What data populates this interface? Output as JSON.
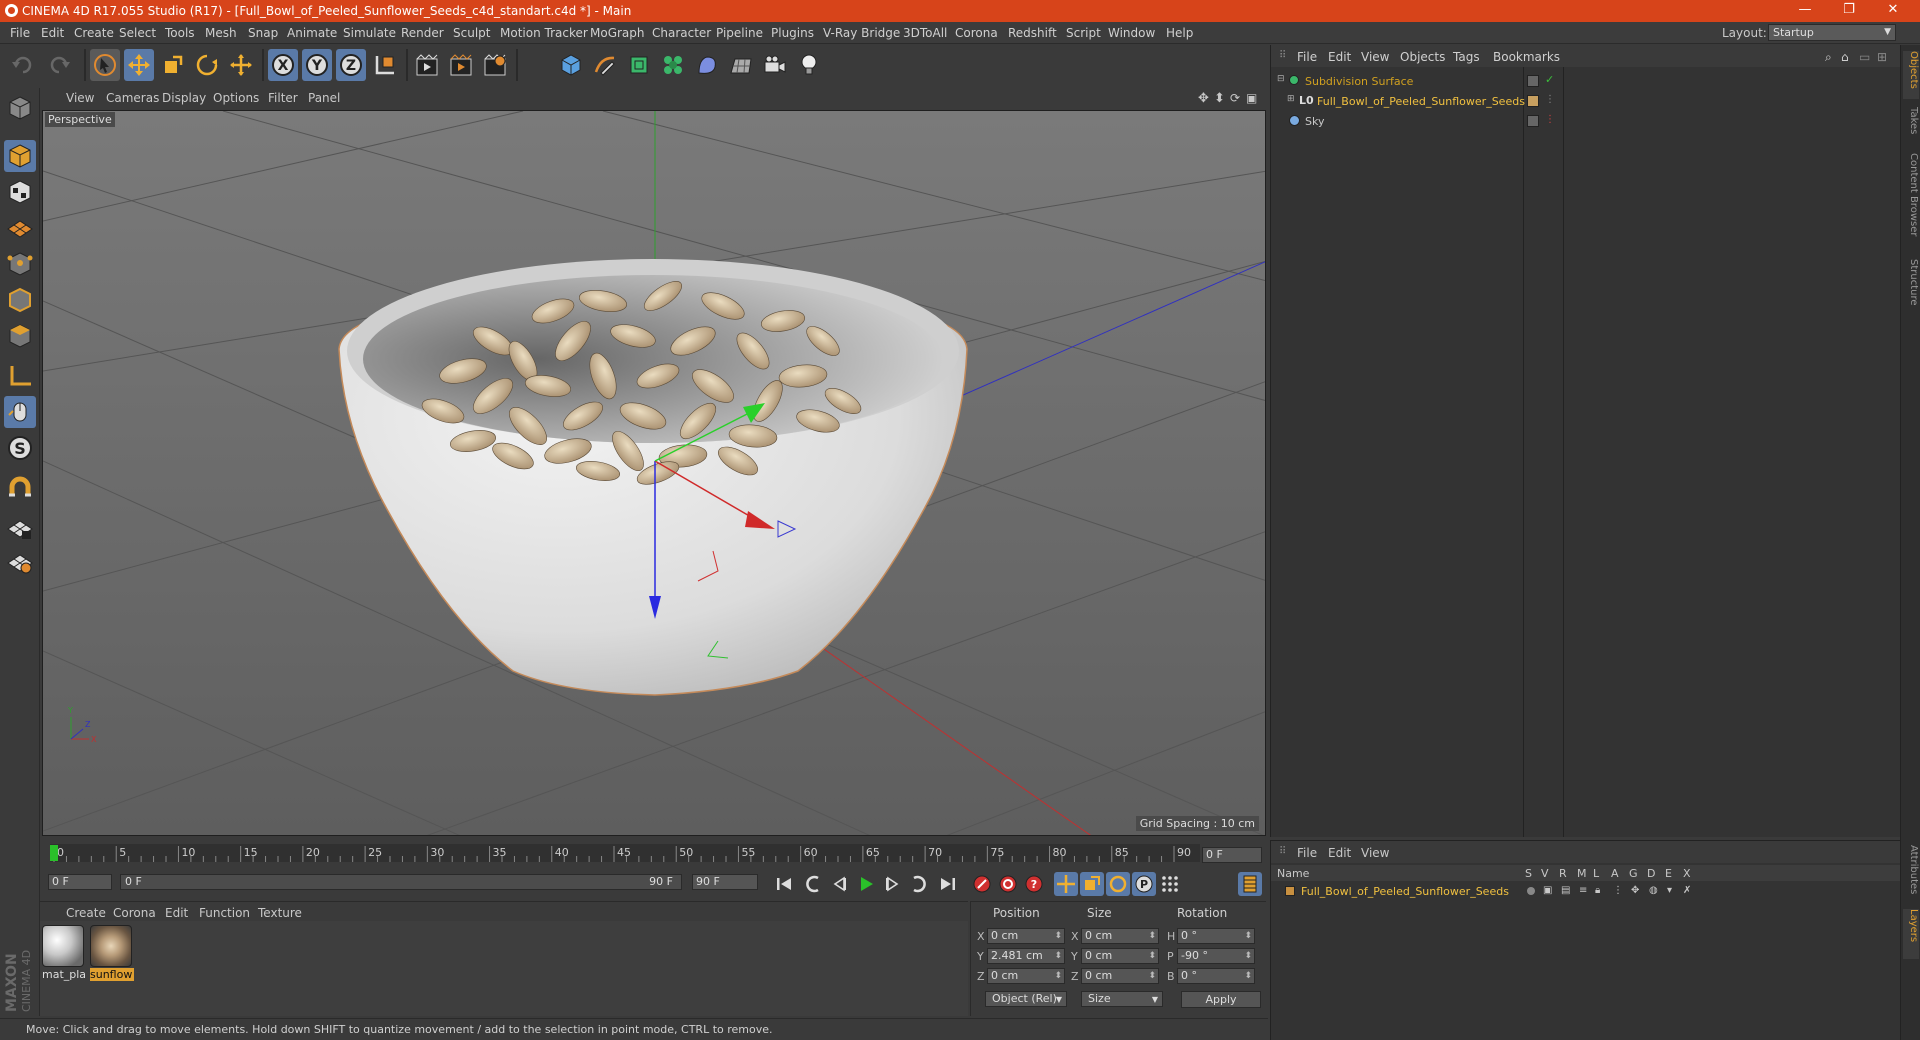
{
  "title_bar": {
    "title": "CINEMA 4D R17.055 Studio (R17) - [Full_Bowl_of_Peeled_Sunflower_Seeds_c4d_standart.c4d *] - Main",
    "minimize": "—",
    "restore": "❐",
    "close": "✕"
  },
  "menu": {
    "items": [
      "File",
      "Edit",
      "Create",
      "Select",
      "Tools",
      "Mesh",
      "Snap",
      "Animate",
      "Simulate",
      "Render",
      "Sculpt",
      "Motion Tracker",
      "MoGraph",
      "Character",
      "Pipeline",
      "Plugins",
      "V-Ray Bridge",
      "3DToAll",
      "Corona",
      "Redshift",
      "Script",
      "Window",
      "Help"
    ],
    "layout_label": "Layout:",
    "layout_value": "Startup"
  },
  "viewport": {
    "menu": [
      "View",
      "Cameras",
      "Display",
      "Options",
      "Filter",
      "Panel"
    ],
    "label": "Perspective",
    "grid_spacing": "Grid Spacing : 10 cm"
  },
  "timeline": {
    "ticks": [
      "0",
      "5",
      "10",
      "15",
      "20",
      "25",
      "30",
      "35",
      "40",
      "45",
      "50",
      "55",
      "60",
      "65",
      "70",
      "75",
      "80",
      "85",
      "90"
    ],
    "current_frame": "0 F",
    "start_field": "0 F",
    "range_start": "0 F",
    "range_end": "90 F",
    "end_field": "90 F"
  },
  "materials": {
    "menu": [
      "Create",
      "Corona",
      "Edit",
      "Function",
      "Texture"
    ],
    "items": [
      {
        "name": "mat_pla",
        "selected": false
      },
      {
        "name": "sunflow",
        "selected": true
      }
    ]
  },
  "coordinates": {
    "headers": [
      "Position",
      "Size",
      "Rotation"
    ],
    "rows": [
      {
        "axis": "X",
        "pos": "0 cm",
        "size_axis": "X",
        "size": "0 cm",
        "rot_axis": "H",
        "rot": "0 °"
      },
      {
        "axis": "Y",
        "pos": "2.481 cm",
        "size_axis": "Y",
        "size": "0 cm",
        "rot_axis": "P",
        "rot": "-90 °"
      },
      {
        "axis": "Z",
        "pos": "0 cm",
        "size_axis": "Z",
        "size": "0 cm",
        "rot_axis": "B",
        "rot": "0 °"
      }
    ],
    "mode": "Object (Rel)",
    "size_mode": "Size",
    "apply": "Apply"
  },
  "status": "Move: Click and drag to move elements. Hold down SHIFT to quantize movement / add to the selection in point mode, CTRL to remove.",
  "objects": {
    "menu": [
      "File",
      "Edit",
      "View",
      "Objects",
      "Tags",
      "Bookmarks"
    ],
    "items": [
      {
        "name": "Subdivision Surface",
        "color": "#d0a020"
      },
      {
        "name": "Full_Bowl_of_Peeled_Sunflower_Seeds",
        "color": "#f0c040"
      },
      {
        "name": "Sky",
        "color": "#c8c8c8"
      }
    ]
  },
  "layers": {
    "menu": [
      "File",
      "Edit",
      "View"
    ],
    "columns": [
      "Name",
      "S",
      "V",
      "R",
      "M",
      "L",
      "A",
      "G",
      "D",
      "E",
      "X"
    ],
    "items": [
      {
        "name": "Full_Bowl_of_Peeled_Sunflower_Seeds"
      }
    ]
  },
  "side_tabs": [
    "Objects",
    "Takes",
    "Content Browser",
    "Structure",
    "Attributes",
    "Layers"
  ],
  "maxon": {
    "line1": "MAXON",
    "line2": "CINEMA 4D"
  },
  "colors": {
    "accent": "#d7441a",
    "highlight": "#e0a030"
  }
}
